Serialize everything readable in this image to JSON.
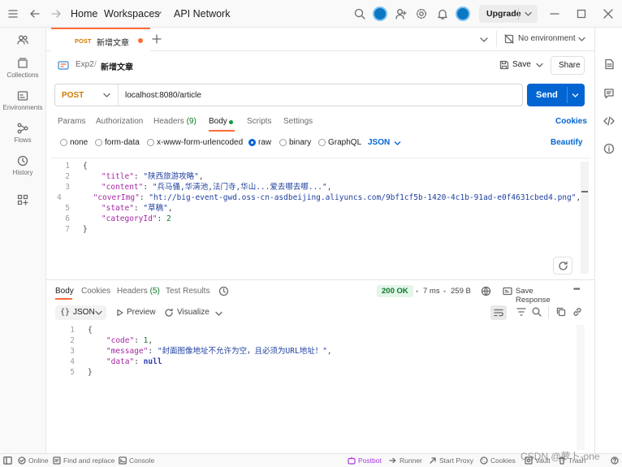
{
  "titlebar": {
    "nav_home": "Home",
    "nav_workspaces": "Workspaces",
    "nav_api_network": "API Network",
    "upgrade": "Upgrade"
  },
  "rail": [
    {
      "label": ""
    },
    {
      "label": "Collections"
    },
    {
      "label": "Environments"
    },
    {
      "label": "Flows"
    },
    {
      "label": "History"
    },
    {
      "label": ""
    }
  ],
  "tab": {
    "method": "POST",
    "title": "新增文章"
  },
  "env": {
    "label": "No environment"
  },
  "breadcrumb": {
    "collection": "Exp2",
    "sep": "/",
    "request": "新增文章"
  },
  "actions": {
    "save": "Save",
    "share": "Share"
  },
  "request": {
    "method": "POST",
    "url": "localhost:8080/article",
    "send": "Send"
  },
  "req_tabs": [
    {
      "label": "Params"
    },
    {
      "label": "Authorization"
    },
    {
      "label": "Headers",
      "count": "(9)"
    },
    {
      "label": "Body"
    },
    {
      "label": "Scripts"
    },
    {
      "label": "Settings"
    }
  ],
  "cookies": "Cookies",
  "body_modes": [
    "none",
    "form-data",
    "x-www-form-urlencoded",
    "raw",
    "binary",
    "GraphQL"
  ],
  "body_format": "JSON",
  "beautify": "Beautify",
  "request_body": {
    "lines": [
      {
        "n": "1",
        "parts": [
          {
            "t": "{",
            "c": "p"
          }
        ]
      },
      {
        "n": "2",
        "parts": [
          {
            "t": "    \"title\"",
            "c": "k"
          },
          {
            "t": ": ",
            "c": "p"
          },
          {
            "t": "\"陕西旅游攻略\"",
            "c": "s"
          },
          {
            "t": ",",
            "c": "p"
          }
        ]
      },
      {
        "n": "3",
        "parts": [
          {
            "t": "    \"content\"",
            "c": "k"
          },
          {
            "t": ": ",
            "c": "p"
          },
          {
            "t": "\"兵马俑,华清池,法门寺,华山...爱去哪去哪...\"",
            "c": "s"
          },
          {
            "t": ",",
            "c": "p"
          }
        ]
      },
      {
        "n": "4",
        "parts": [
          {
            "t": "    \"coverImg\"",
            "c": "k"
          },
          {
            "t": ": ",
            "c": "p"
          },
          {
            "t": "\"ht://big-event-gwd.oss-cn-asdbeijing.aliyuncs.com/9bf1cf5b-1420-4c1b-91ad-e0f4631cbed4.png\"",
            "c": "s"
          },
          {
            "t": ",",
            "c": "p"
          }
        ]
      },
      {
        "n": "5",
        "parts": [
          {
            "t": "    \"state\"",
            "c": "k"
          },
          {
            "t": ": ",
            "c": "p"
          },
          {
            "t": "\"草稿\"",
            "c": "s"
          },
          {
            "t": ",",
            "c": "p"
          }
        ]
      },
      {
        "n": "6",
        "parts": [
          {
            "t": "    \"categoryId\"",
            "c": "k"
          },
          {
            "t": ": ",
            "c": "p"
          },
          {
            "t": "2",
            "c": "n"
          }
        ]
      },
      {
        "n": "7",
        "parts": [
          {
            "t": "}",
            "c": "p"
          }
        ]
      }
    ]
  },
  "resp_tabs": [
    {
      "label": "Body"
    },
    {
      "label": "Cookies"
    },
    {
      "label": "Headers",
      "count": "(5)"
    },
    {
      "label": "Test Results"
    }
  ],
  "resp_meta": {
    "status": "200 OK",
    "time": "7 ms",
    "size": "259 B",
    "save": "Save Response"
  },
  "resp_toolbar": {
    "format": "JSON",
    "preview": "Preview",
    "visualize": "Visualize"
  },
  "response_body": {
    "lines": [
      {
        "n": "1",
        "parts": [
          {
            "t": "{",
            "c": "p"
          }
        ]
      },
      {
        "n": "2",
        "parts": [
          {
            "t": "    \"code\"",
            "c": "k"
          },
          {
            "t": ": ",
            "c": "p"
          },
          {
            "t": "1",
            "c": "n"
          },
          {
            "t": ",",
            "c": "p"
          }
        ]
      },
      {
        "n": "3",
        "parts": [
          {
            "t": "    \"message\"",
            "c": "k"
          },
          {
            "t": ": ",
            "c": "p"
          },
          {
            "t": "\"封面图像地址不允许为空，且必须为URL地址！\"",
            "c": "s"
          },
          {
            "t": ",",
            "c": "p"
          }
        ]
      },
      {
        "n": "4",
        "parts": [
          {
            "t": "    \"data\"",
            "c": "k"
          },
          {
            "t": ": ",
            "c": "p"
          },
          {
            "t": "null",
            "c": "b"
          }
        ]
      },
      {
        "n": "5",
        "parts": [
          {
            "t": "}",
            "c": "p"
          }
        ]
      }
    ]
  },
  "statusbar": {
    "online": "Online",
    "find": "Find and replace",
    "console": "Console",
    "postbot": "Postbot",
    "runner": "Runner",
    "proxy": "Start Proxy",
    "cookies": "Cookies",
    "vault": "Vault",
    "trash": "Trash"
  },
  "watermark": "CSDN @萝卜-one",
  "colors": {
    "accent": "#ff6c37",
    "send": "#0265d2",
    "status_ok": "#0b7a2b"
  }
}
